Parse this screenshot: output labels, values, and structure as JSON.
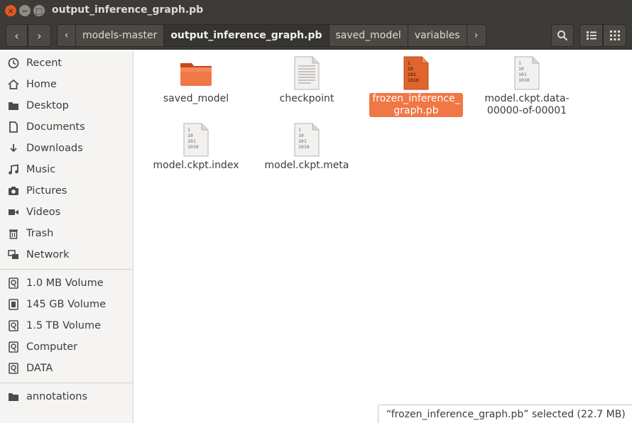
{
  "window": {
    "title": "output_inference_graph.pb",
    "close_glyph": "×",
    "min_glyph": "−",
    "max_glyph": "□"
  },
  "toolbar": {
    "back_glyph": "‹",
    "forward_glyph": "›",
    "path_left_arrow": "‹",
    "path_right_arrow": "›",
    "path": [
      "models-master",
      "output_inference_graph.pb",
      "saved_model",
      "variables"
    ],
    "current_index": 1
  },
  "sidebar": {
    "places": [
      {
        "label": "Recent",
        "icon": "clock-icon"
      },
      {
        "label": "Home",
        "icon": "home-icon"
      },
      {
        "label": "Desktop",
        "icon": "folder-icon"
      },
      {
        "label": "Documents",
        "icon": "document-icon"
      },
      {
        "label": "Downloads",
        "icon": "download-icon"
      },
      {
        "label": "Music",
        "icon": "music-icon"
      },
      {
        "label": "Pictures",
        "icon": "camera-icon"
      },
      {
        "label": "Videos",
        "icon": "video-icon"
      },
      {
        "label": "Trash",
        "icon": "trash-icon"
      },
      {
        "label": "Network",
        "icon": "network-icon"
      }
    ],
    "devices": [
      {
        "label": "1.0 MB Volume",
        "icon": "drive-icon"
      },
      {
        "label": "145 GB Volume",
        "icon": "chip-icon"
      },
      {
        "label": "1.5 TB Volume",
        "icon": "drive-icon"
      },
      {
        "label": "Computer",
        "icon": "drive-icon"
      },
      {
        "label": "DATA",
        "icon": "drive-icon"
      }
    ],
    "bookmarks": [
      {
        "label": "annotations",
        "icon": "folder-icon"
      }
    ]
  },
  "files": [
    {
      "name": "saved_model",
      "type": "folder"
    },
    {
      "name": "checkpoint",
      "type": "text"
    },
    {
      "name": "frozen_inference_\ngraph.pb",
      "type": "binary",
      "selected": true
    },
    {
      "name": "model.ckpt.data-\n00000-of-00001",
      "type": "binary"
    },
    {
      "name": "model.ckpt.index",
      "type": "binary"
    },
    {
      "name": "model.ckpt.meta",
      "type": "binary"
    }
  ],
  "binary_glyph_lines": [
    "1",
    "10",
    "101",
    "1010"
  ],
  "status": {
    "text": "“frozen_inference_graph.pb” selected  (22.7 MB)"
  },
  "colors": {
    "accent": "#f07746",
    "folder": "#e85d22",
    "titlebar": "#3c3b37"
  }
}
